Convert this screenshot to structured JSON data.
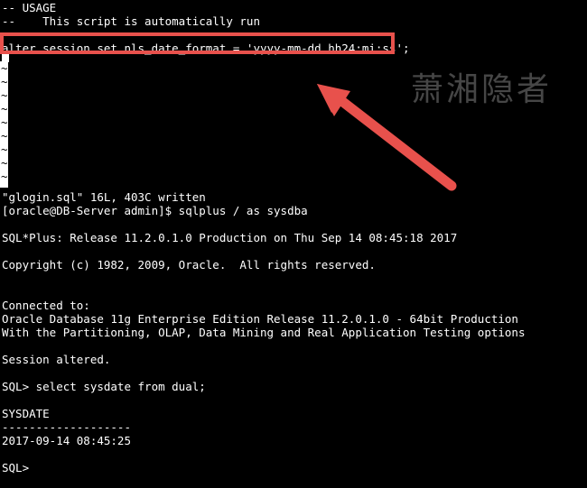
{
  "terminal": {
    "background_color": "#000000",
    "foreground_color": "#ffffff",
    "lines": [
      "-- USAGE",
      "--    This script is automatically run",
      "--",
      "alter session set nls_date_format = 'yyyy-mm-dd hh24:mi:ss';",
      "",
      "",
      "",
      "",
      "",
      "",
      "",
      "",
      "",
      "",
      "\"glogin.sql\" 16L, 403C written",
      "[oracle@DB-Server admin]$ sqlplus / as sysdba",
      "",
      "SQL*Plus: Release 11.2.0.1.0 Production on Thu Sep 14 08:45:18 2017",
      "",
      "Copyright (c) 1982, 2009, Oracle.  All rights reserved.",
      "",
      "",
      "Connected to:",
      "Oracle Database 11g Enterprise Edition Release 11.2.0.1.0 - 64bit Production",
      "With the Partitioning, OLAP, Data Mining and Real Application Testing options",
      "",
      "Session altered.",
      "",
      "SQL> select sysdate from dual;",
      "",
      "SYSDATE",
      "-------------------",
      "2017-09-14 08:45:25",
      "",
      "SQL>"
    ],
    "vim_filler_tildes": [
      "~",
      "~",
      "~",
      "~",
      "~",
      "~",
      "~",
      "~",
      "~"
    ],
    "cursor": {
      "name": "block-cursor",
      "column": 0,
      "visible": true
    }
  },
  "editor_status": {
    "file_name": "glogin.sql",
    "lines_count": "16L",
    "bytes_count": "403C",
    "status_text": "\"glogin.sql\" 16L, 403C written"
  },
  "shell": {
    "prompt": "[oracle@DB-Server admin]$",
    "command": "sqlplus / as sysdba",
    "user": "oracle",
    "host": "DB-Server",
    "cwd": "admin"
  },
  "sqlplus": {
    "banner": "SQL*Plus: Release 11.2.0.1.0 Production on Thu Sep 14 08:45:18 2017",
    "copyright": "Copyright (c) 1982, 2009, Oracle.  All rights reserved.",
    "connected_label": "Connected to:",
    "db_version": "Oracle Database 11g Enterprise Edition Release 11.2.0.1.0 - 64bit Production",
    "db_options": "With the Partitioning, OLAP, Data Mining and Real Application Testing options",
    "session_altered": "Session altered.",
    "prompt": "SQL>",
    "query": "SQL> select sysdate from dual;",
    "result_header": "SYSDATE",
    "result_separator": "-------------------",
    "result_value": "2017-09-14 08:45:25",
    "final_prompt": "SQL>"
  },
  "annotations": {
    "highlight_rect": {
      "label": "alter session set nls_date_format = 'yyyy-mm-dd hh24:mi:ss';",
      "color": "#e8514c",
      "border_width_px": 4
    },
    "arrow": {
      "color": "#e8514c",
      "points_from": "bottom-right",
      "points_to": "top-left",
      "target": "alter session set nls_date_format statement"
    },
    "watermark": {
      "text": "萧湘隐者",
      "color": "#4a4a4a"
    }
  }
}
